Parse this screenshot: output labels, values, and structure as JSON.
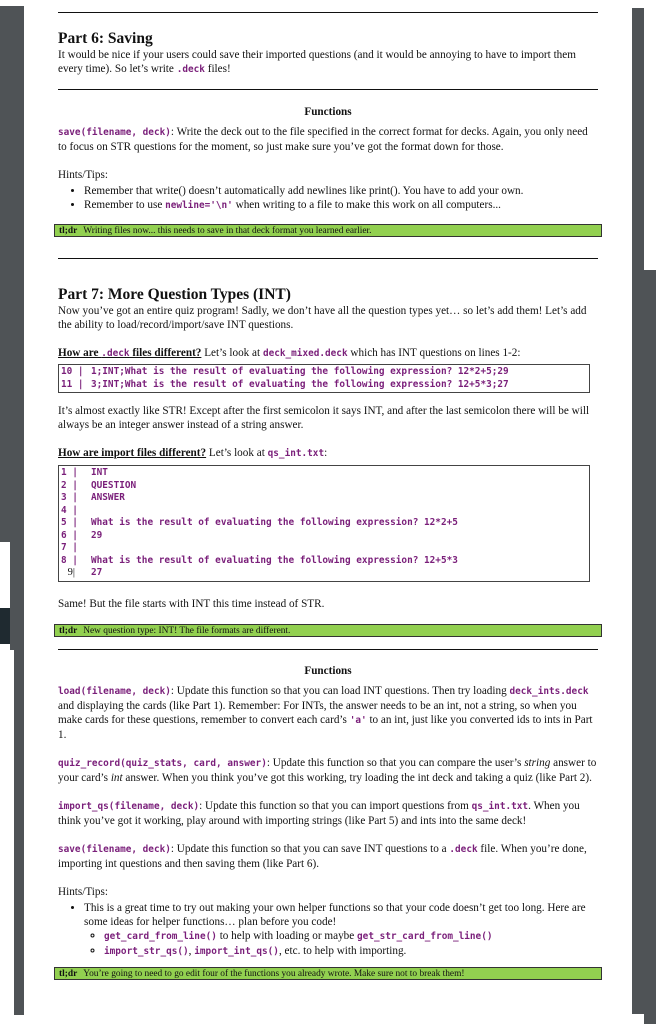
{
  "part6": {
    "title": "Part 6: Saving",
    "intro_a": "It would be nice if your users could save their imported questions (and it would be annoying to have to import them every time). So let’s write ",
    "intro_code": ".deck",
    "intro_b": " files!",
    "functions_heading": "Functions",
    "save_sig": "save(filename, deck)",
    "save_desc": ": Write the deck out to the file specified in the correct format for decks. Again, you only need to focus on STR questions for the moment, so just make sure you’ve got the format down for those.",
    "hints_label": "Hints/Tips:",
    "hint1": "Remember that write() doesn’t automatically add newlines like print(). You have to add your own.",
    "hint2_a": "Remember to use ",
    "hint2_code": "newline='\\n'",
    "hint2_b": " when writing to a file to make this work on all computers...",
    "tldr_label": "tl;dr",
    "tldr_text": "Writing files now... this needs to save in that deck format you learned earlier."
  },
  "part7": {
    "title": "Part 7: More Question Types (INT)",
    "intro": "Now you’ve got an entire quiz program! Sadly, we don’t have all the question types yet… so let’s add them! Let’s add the ability to load/record/import/save INT questions.",
    "deck_q_a": "How are ",
    "deck_q_code": ".deck",
    "deck_q_b": " files different?",
    "deck_look_a": " Let’s look at ",
    "deck_look_code": "deck_mixed.deck",
    "deck_look_b": " which has INT questions on lines 1-2:",
    "deck_lines": [
      {
        "n": "10 |",
        "text": "1;INT;What is the result of evaluating the following expression? 12*2+5;29"
      },
      {
        "n": "11 |",
        "text": "3;INT;What is the result of evaluating the following expression? 12+5*3;27"
      }
    ],
    "deck_note": "It’s almost exactly like STR! Except after the first semicolon it says INT, and after the last semicolon there will be will always be an integer answer instead of a string answer.",
    "import_q": "How are import files different?",
    "import_look_a": " Let’s look at ",
    "import_look_code": "qs_int.txt",
    "import_look_b": ":",
    "import_lines": [
      {
        "n": "1 |",
        "text": "INT"
      },
      {
        "n": "2 |",
        "text": "QUESTION"
      },
      {
        "n": "3 |",
        "text": "ANSWER"
      },
      {
        "n": "4 |",
        "text": ""
      },
      {
        "n": "5 |",
        "text": "What is the result of evaluating the following expression? 12*2+5"
      },
      {
        "n": "6 |",
        "text": "29"
      },
      {
        "n": "7 |",
        "text": ""
      },
      {
        "n": "8 |",
        "text": "What is the result of evaluating the following expression? 12+5*3"
      },
      {
        "n": "9|",
        "text": "27"
      }
    ],
    "import_note": "Same! But the file starts with INT this time instead of STR.",
    "tldr1_label": "tl;dr",
    "tldr1_text": "New question type: INT! The file formats are different.",
    "functions_heading": "Functions",
    "load_sig": "load(filename, deck)",
    "load_a": ": Update this function so that you can load INT questions. Then try loading ",
    "load_code": "deck_ints.deck",
    "load_b": " and displaying the cards (like Part 1). Remember: For INTs, the answer needs to be an int, not a string, so when you make cards for these questions, remember to convert each card’s ",
    "load_code2": "'a'",
    "load_c": " to an int, just like you converted ids to ints in Part 1.",
    "qr_sig": "quiz_record(quiz_stats, card, answer)",
    "qr_a": ": Update this function so that you can compare the user’s ",
    "qr_i1": "string",
    "qr_b": " answer to your card’s ",
    "qr_i2": "int",
    "qr_c": " answer. When you think you’ve got this working, try loading the int deck and taking a quiz (like Part 2).",
    "imp_sig": "import_qs(filename, deck)",
    "imp_a": ": Update this function so that you can import questions from ",
    "imp_code": "qs_int.txt",
    "imp_b": ". When you think you’ve got it working, play around with importing strings (like Part 5) and ints into the same deck!",
    "save_sig": "save(filename, deck)",
    "save_a": ": Update this function so that you can save INT questions to a ",
    "save_code": ".deck",
    "save_b": " file. When you’re done, importing int questions and then saving them (like Part 6).",
    "hints_label": "Hints/Tips:",
    "hint1": "This is a great time to try out making your own helper functions so that your code doesn’t get too long. Here are some ideas for helper functions… plan before you code!",
    "sub1_code": "get_card_from_line()",
    "sub1_a": " to help with loading or maybe ",
    "sub1_code2": "get_str_card_from_line()",
    "sub2_code": "import_str_qs()",
    "sub2_sep": ", ",
    "sub2_code2": "import_int_qs()",
    "sub2_a": ", etc. to help with importing.",
    "tldr2_label": "tl;dr",
    "tldr2_text": "You’re going to need to go edit four of the functions you already wrote. Make sure not to break them!"
  }
}
